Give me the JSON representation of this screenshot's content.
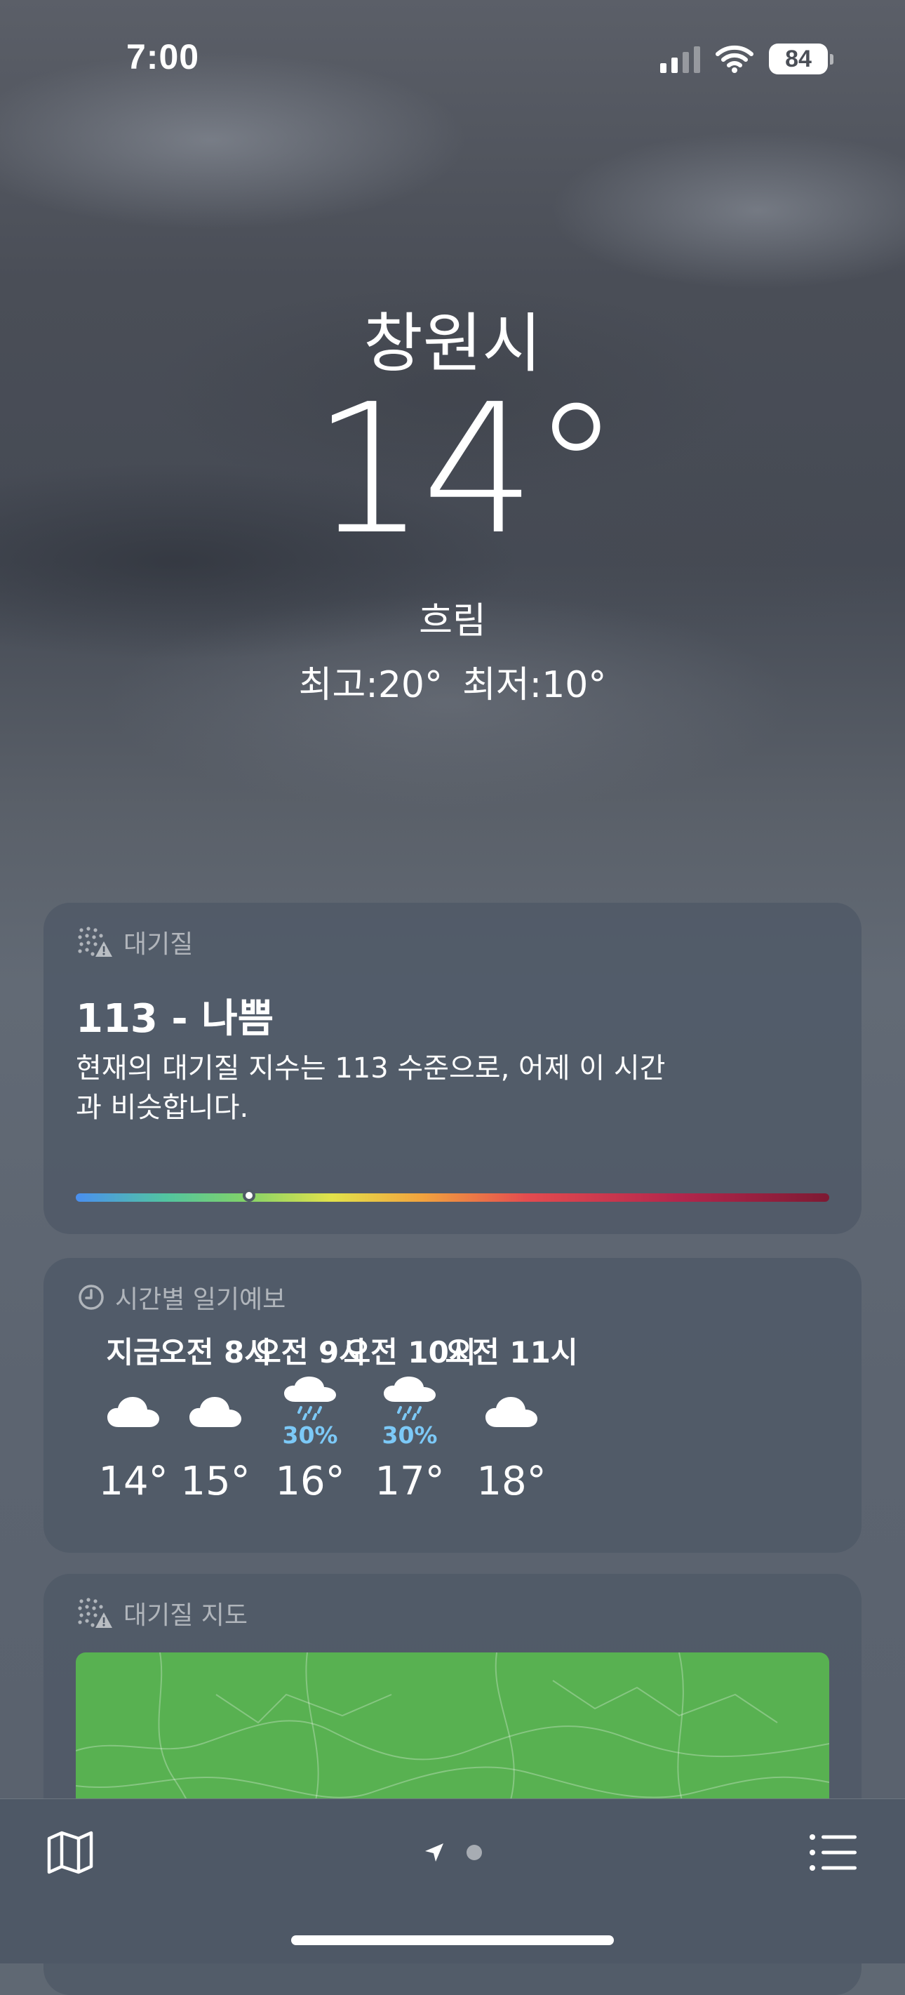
{
  "status_bar": {
    "time": "7:00",
    "battery": "84",
    "signal_bars_active": 2,
    "signal_bars_total": 4,
    "icons": [
      "cellular-signal-icon",
      "wifi-icon",
      "battery-icon"
    ]
  },
  "header": {
    "city": "창원시",
    "temperature": "14°",
    "condition": "흐림",
    "high": "최고:20°",
    "low": "최저:10°"
  },
  "air_quality": {
    "title": "대기질",
    "value": "113 - 나쁨",
    "description": "현재의 대기질 지수는 113 수준으로, 어제 이 시간과 비슷합니다.",
    "level_fraction": 0.23,
    "icon": "air-quality-icon"
  },
  "hourly": {
    "title": "시간별 일기예보",
    "icon": "clock-icon",
    "items": [
      {
        "label": "지금",
        "icon": "cloud",
        "pop": "",
        "temp": "14°"
      },
      {
        "label": "오전 8시",
        "icon": "cloud",
        "pop": "",
        "temp": "15°"
      },
      {
        "label": "오전 9시",
        "icon": "cloud-rain",
        "pop": "30%",
        "temp": "16°"
      },
      {
        "label": "오전 10시",
        "icon": "cloud-rain",
        "pop": "30%",
        "temp": "17°"
      },
      {
        "label": "오전 11시",
        "icon": "cloud",
        "pop": "",
        "temp": "18°"
      }
    ]
  },
  "air_quality_map": {
    "title": "대기질 지도",
    "icon": "air-quality-icon",
    "map_color": "#58b151"
  },
  "toolbar": {
    "map_icon": "map-icon",
    "location_icon": "location-arrow-icon",
    "list_icon": "list-icon",
    "pages": 2,
    "current_page": 1
  },
  "colors": {
    "precipitation": "#7cc9f7",
    "card_background": "#4e5866"
  }
}
